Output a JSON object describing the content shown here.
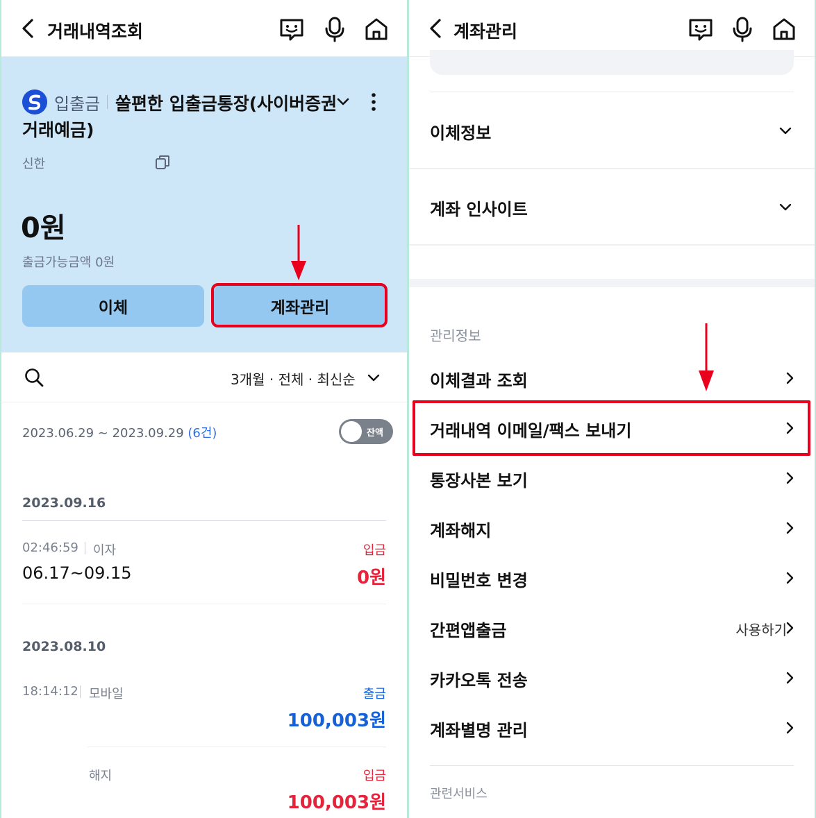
{
  "left": {
    "header": {
      "title": "거래내역조회"
    },
    "account": {
      "type_label": "입출금",
      "name_line1": "쏠편한 입출금통장(사이버증권",
      "name_line2": "거래예금)",
      "bank": "신한",
      "balance": "0원",
      "available": "출금가능금액 0원",
      "transfer_button": "이체",
      "manage_button": "계좌관리"
    },
    "filter": {
      "summary": "3개월 · 전체 · 최신순"
    },
    "list": {
      "range": "2023.06.29 ~ 2023.09.29",
      "count": "(6건)",
      "toggle_label": "잔액",
      "groups": [
        {
          "date": "2023.09.16",
          "items": [
            {
              "time": "02:46:59",
              "desc": "이자",
              "title": "06.17~09.15",
              "kind": "입금",
              "amount": "0원"
            }
          ]
        },
        {
          "date": "2023.08.10",
          "items": [
            {
              "time": "18:14:12",
              "desc": "모바일",
              "title": "",
              "kind": "출금",
              "amount": "100,003원"
            },
            {
              "time": "",
              "desc": "해지",
              "title": "",
              "kind": "입금",
              "amount": "100,003원"
            }
          ]
        }
      ]
    }
  },
  "right": {
    "header": {
      "title": "계좌관리"
    },
    "accordions": [
      {
        "label": "이체정보"
      },
      {
        "label": "계좌 인사이트"
      }
    ],
    "section_label": "관리정보",
    "menu": [
      {
        "label": "이체결과 조회",
        "side": ""
      },
      {
        "label": "거래내역 이메일/팩스 보내기",
        "side": ""
      },
      {
        "label": "통장사본 보기",
        "side": ""
      },
      {
        "label": "계좌해지",
        "side": ""
      },
      {
        "label": "비밀번호 변경",
        "side": ""
      },
      {
        "label": "간편앱출금",
        "side": "사용하기"
      },
      {
        "label": "카카오톡 전송",
        "side": ""
      },
      {
        "label": "계좌별명 관리",
        "side": ""
      }
    ],
    "related_label": "관련서비스"
  },
  "colors": {
    "accent_red": "#e8001c",
    "account_bg": "#cde6f8",
    "button_bg": "#95c8f1",
    "deposit": "#e5243b",
    "withdraw": "#1561d8"
  }
}
